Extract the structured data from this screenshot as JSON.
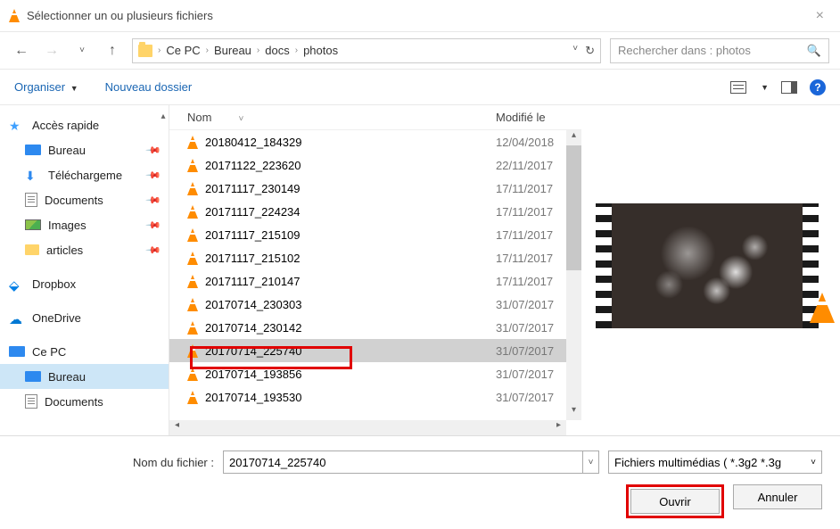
{
  "title": "Sélectionner un ou plusieurs fichiers",
  "breadcrumb": [
    "Ce PC",
    "Bureau",
    "docs",
    "photos"
  ],
  "search_placeholder": "Rechercher dans : photos",
  "toolbar": {
    "organize": "Organiser",
    "new_folder": "Nouveau dossier"
  },
  "sidebar": {
    "quick_access": "Accès rapide",
    "items": [
      {
        "label": "Bureau",
        "icon": "desktop",
        "pinned": true
      },
      {
        "label": "Téléchargeme",
        "icon": "download",
        "pinned": true
      },
      {
        "label": "Documents",
        "icon": "doc",
        "pinned": true
      },
      {
        "label": "Images",
        "icon": "img",
        "pinned": true
      },
      {
        "label": "articles",
        "icon": "folder",
        "pinned": true
      }
    ],
    "dropbox": "Dropbox",
    "onedrive": "OneDrive",
    "cepc": "Ce PC",
    "bureau": "Bureau",
    "documents": "Documents"
  },
  "columns": {
    "name": "Nom",
    "modified": "Modifié le"
  },
  "files": [
    {
      "name": "20180412_184329",
      "date": "12/04/2018"
    },
    {
      "name": "20171122_223620",
      "date": "22/11/2017"
    },
    {
      "name": "20171117_230149",
      "date": "17/11/2017"
    },
    {
      "name": "20171117_224234",
      "date": "17/11/2017"
    },
    {
      "name": "20171117_215109",
      "date": "17/11/2017"
    },
    {
      "name": "20171117_215102",
      "date": "17/11/2017"
    },
    {
      "name": "20171117_210147",
      "date": "17/11/2017"
    },
    {
      "name": "20170714_230303",
      "date": "31/07/2017"
    },
    {
      "name": "20170714_230142",
      "date": "31/07/2017"
    },
    {
      "name": "20170714_225740",
      "date": "31/07/2017",
      "selected": true
    },
    {
      "name": "20170714_193856",
      "date": "31/07/2017"
    },
    {
      "name": "20170714_193530",
      "date": "31/07/2017"
    }
  ],
  "bottom": {
    "filename_label": "Nom du fichier :",
    "filename_value": "20170714_225740",
    "filter": "Fichiers multimédias ( *.3g2 *.3g",
    "open": "Ouvrir",
    "cancel": "Annuler"
  }
}
